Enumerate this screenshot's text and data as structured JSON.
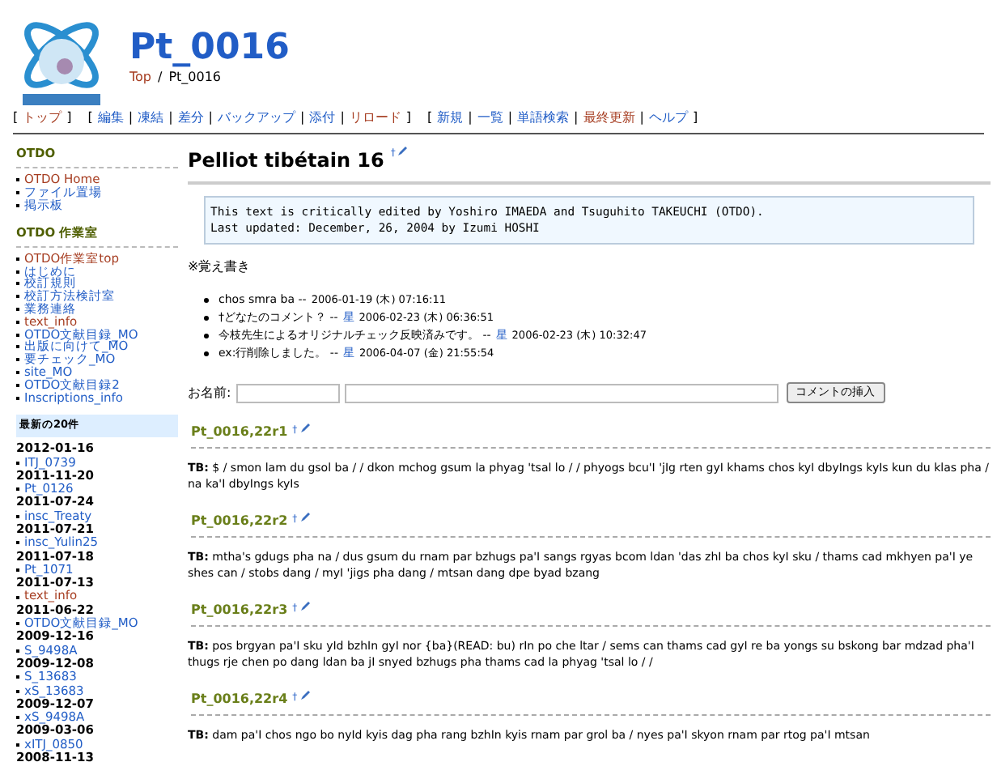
{
  "header": {
    "title": "Pt_0016",
    "breadcrumb": [
      {
        "label": "Top",
        "visited": true
      },
      {
        "label": "Pt_0016",
        "visited": false
      }
    ],
    "separator": "/"
  },
  "nav_punct": {
    "open": "[",
    "close": "]",
    "separator": "|"
  },
  "nav": [
    [
      {
        "label": "トップ",
        "visited": true
      }
    ],
    [
      {
        "label": "編集",
        "visited": false
      },
      {
        "label": "凍結",
        "visited": false
      },
      {
        "label": "差分",
        "visited": false
      },
      {
        "label": "バックアップ",
        "visited": false
      },
      {
        "label": "添付",
        "visited": false
      },
      {
        "label": "リロード",
        "visited": true
      }
    ],
    [
      {
        "label": "新規",
        "visited": false
      },
      {
        "label": "一覧",
        "visited": false
      },
      {
        "label": "単語検索",
        "visited": false
      },
      {
        "label": "最終更新",
        "visited": true
      },
      {
        "label": "ヘルプ",
        "visited": false
      }
    ]
  ],
  "sidebar": {
    "sections": [
      {
        "title": "OTDO",
        "items": [
          {
            "label": "OTDO Home",
            "visited": true
          },
          {
            "label": "ファイル置場",
            "visited": false
          },
          {
            "label": "掲示板",
            "visited": false
          }
        ]
      },
      {
        "title": "OTDO 作業室",
        "items": [
          {
            "label": "OTDO作業室top",
            "visited": true
          },
          {
            "label": "はじめに",
            "visited": false
          },
          {
            "label": "校訂規則",
            "visited": false
          },
          {
            "label": "校訂方法検討室",
            "visited": false
          },
          {
            "label": "業務連絡",
            "visited": false
          },
          {
            "label": "text_info",
            "visited": true
          },
          {
            "label": "OTDO文献目録_MO",
            "visited": false
          },
          {
            "label": "出版に向けて_MO",
            "visited": false
          },
          {
            "label": "要チェック_MO",
            "visited": false
          },
          {
            "label": "site_MO",
            "visited": false
          },
          {
            "label": "OTDO文献目録2",
            "visited": false
          },
          {
            "label": "Inscriptions_info",
            "visited": false
          }
        ]
      }
    ],
    "recent": {
      "title": "最新の20件",
      "groups": [
        {
          "date": "2012-01-16",
          "pages": [
            {
              "label": "ITJ_0739",
              "visited": false
            }
          ]
        },
        {
          "date": "2011-11-20",
          "pages": [
            {
              "label": "Pt_0126",
              "visited": false
            }
          ]
        },
        {
          "date": "2011-07-24",
          "pages": [
            {
              "label": "insc_Treaty",
              "visited": false
            }
          ]
        },
        {
          "date": "2011-07-21",
          "pages": [
            {
              "label": "insc_Yulin25",
              "visited": false
            }
          ]
        },
        {
          "date": "2011-07-18",
          "pages": [
            {
              "label": "Pt_1071",
              "visited": false
            }
          ]
        },
        {
          "date": "2011-07-13",
          "pages": [
            {
              "label": "text_info",
              "visited": true
            }
          ]
        },
        {
          "date": "2011-06-22",
          "pages": [
            {
              "label": "OTDO文献目録_MO",
              "visited": false
            }
          ]
        },
        {
          "date": "2009-12-16",
          "pages": [
            {
              "label": "S_9498A",
              "visited": false
            }
          ]
        },
        {
          "date": "2009-12-08",
          "pages": [
            {
              "label": "S_13683",
              "visited": false
            },
            {
              "label": "xS_13683",
              "visited": false
            }
          ]
        },
        {
          "date": "2009-12-07",
          "pages": [
            {
              "label": "xS_9498A",
              "visited": false
            }
          ]
        },
        {
          "date": "2009-03-06",
          "pages": [
            {
              "label": "xITJ_0850",
              "visited": false
            }
          ]
        },
        {
          "date": "2008-11-13"
        }
      ]
    }
  },
  "main": {
    "title": "Pelliot tibétain 16",
    "top_mark": "†",
    "notice": [
      "This text is critically edited by Yoshiro IMAEDA and Tsuguhito TAKEUCHI (OTDO).",
      "Last updated: December, 26, 2004 by Izumi HOSHI"
    ],
    "memo_label": "※覚え書き",
    "comments": [
      {
        "text": "chos smra ba",
        "sep": "--",
        "time": "2006-01-19 (木) 07:16:11"
      },
      {
        "text": "†どなたのコメント？",
        "sep": "--",
        "author": "星",
        "time": "2006-02-23 (木) 06:36:51"
      },
      {
        "text": "今枝先生によるオリジナルチェック反映済みです。",
        "sep": "--",
        "author": "星",
        "time": "2006-02-23 (木) 10:32:47"
      },
      {
        "text": "ex:行削除しました。",
        "sep": "--",
        "author": "星",
        "time": "2006-04-07 (金) 21:55:54"
      }
    ],
    "comment_form": {
      "name_label": "お名前:",
      "button": "コメントの挿入"
    },
    "sections": [
      {
        "heading": "Pt_0016,22r1",
        "label": "TB:",
        "text": "$ / smon lam du gsol ba / / dkon mchog gsum la phyag 'tsal lo / / phyogs bcu'I 'jIg rten gyI khams chos kyI dbyIngs kyIs kun du klas pha / na ka'I dbyIngs kyIs"
      },
      {
        "heading": "Pt_0016,22r2",
        "label": "TB:",
        "text": "mtha's gdugs pha na / dus gsum du rnam par bzhugs pa'I sangs rgyas bcom ldan 'das zhI ba chos kyI sku / thams cad mkhyen pa'I ye shes can / stobs dang / myI 'jigs pha dang / mtsan dang dpe byad bzang"
      },
      {
        "heading": "Pt_0016,22r3",
        "label": "TB:",
        "text": "pos brgyan pa'I sku yId bzhIn gyI nor {ba}(READ: bu) rIn po che ltar / sems can thams cad gyI re ba yongs su bskong bar mdzad pha'I thugs rje chen po dang ldan ba jI snyed bzhugs pha thams cad la phyag 'tsal lo / /"
      },
      {
        "heading": "Pt_0016,22r4",
        "label": "TB:",
        "text": "dam pa'I chos ngo bo nyId kyis dag pha rang bzhIn kyis rnam par grol ba / nyes pa'I skyon rnam par rtog pa'I mtsan"
      }
    ]
  }
}
